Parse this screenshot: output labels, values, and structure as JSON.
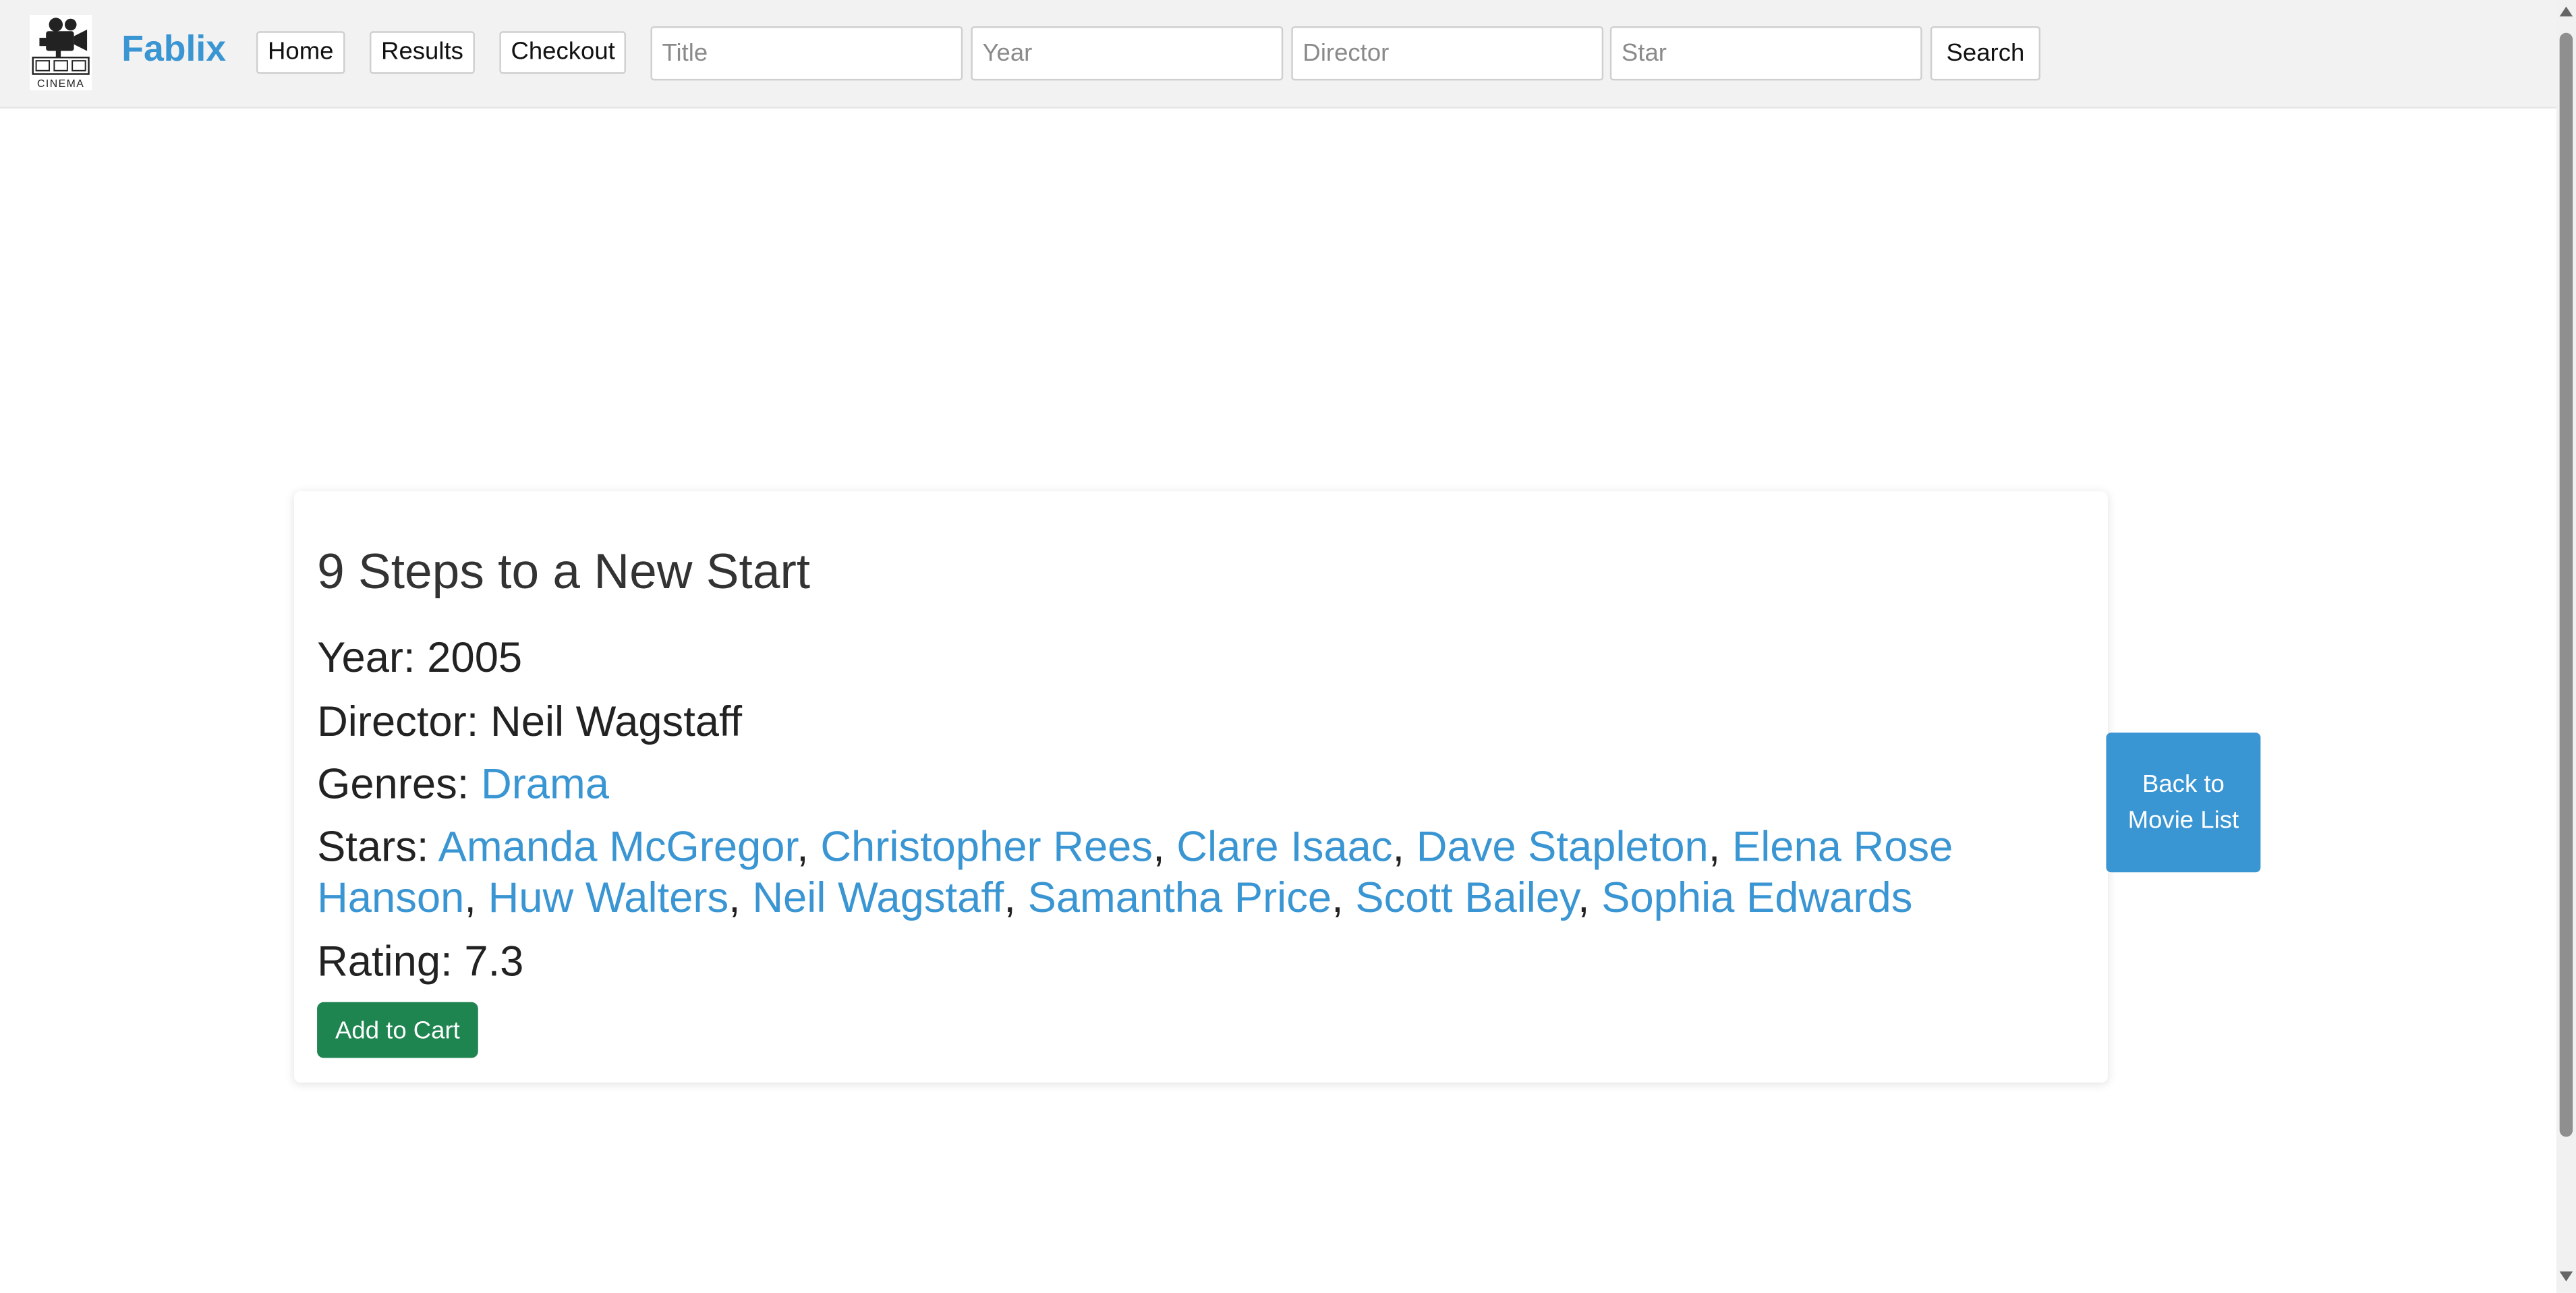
{
  "header": {
    "logo_text": "CINEMA",
    "brand": "Fablix",
    "nav": {
      "home": "Home",
      "results": "Results",
      "checkout": "Checkout"
    },
    "search": {
      "title_placeholder": "Title",
      "year_placeholder": "Year",
      "director_placeholder": "Director",
      "star_placeholder": "Star",
      "button": "Search"
    }
  },
  "movie": {
    "title": "9 Steps to a New Start",
    "year_label": "Year:",
    "year": "2005",
    "director_label": "Director:",
    "director": "Neil Wagstaff",
    "genres_label": "Genres:",
    "genres": [
      "Drama"
    ],
    "stars_label": "Stars:",
    "stars": [
      "Amanda McGregor",
      "Christopher Rees",
      "Clare Isaac",
      "Dave Stapleton",
      "Elena Rose Hanson",
      "Huw Walters",
      "Neil Wagstaff",
      "Samantha Price",
      "Scott Bailey",
      "Sophia Edwards"
    ],
    "rating_label": "Rating:",
    "rating": "7.3",
    "add_to_cart": "Add to Cart"
  },
  "back_button": "Back to Movie List",
  "colors": {
    "link": "#3a95d3",
    "add_button": "#1e8450",
    "back_button": "#3a95d3",
    "topbar": "#f2f2f2"
  },
  "icons": {
    "logo": "cinema-camera-icon"
  }
}
